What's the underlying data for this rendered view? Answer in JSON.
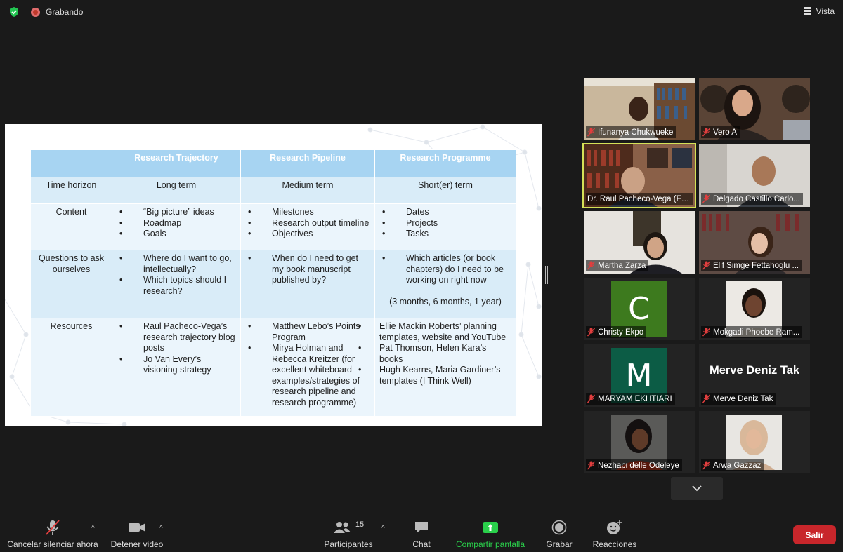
{
  "topbar": {
    "recording_label": "Grabando",
    "view_label": "Vista"
  },
  "slide": {
    "headers": [
      "",
      "Research Trajectory",
      "Research Pipeline",
      "Research Programme"
    ],
    "rows": [
      {
        "label": "Time horizon",
        "cells": [
          "Long term",
          "Medium term",
          "Short(er) term"
        ]
      },
      {
        "label": "Content",
        "lists": [
          [
            "“Big picture” ideas",
            "Roadmap",
            "Goals"
          ],
          [
            "Milestones",
            "Research output timeline",
            "Objectives"
          ],
          [
            "Dates",
            "Projects",
            "Tasks"
          ]
        ]
      },
      {
        "label": "Questions to ask ourselves",
        "lists": [
          [
            "Where do I want to go, intellectually?",
            "Which topics should I research?"
          ],
          [
            "When do I need to get my book manuscript published by?"
          ],
          [
            "Which articles (or book chapters) do I need to be working on right now"
          ]
        ],
        "note": "(3 months, 6 months, 1 year)"
      },
      {
        "label": "Resources",
        "lists": [
          [
            "Raul Pacheco-Vega’s research trajectory blog posts",
            "Jo Van Every’s visioning strategy"
          ],
          [
            "Matthew Lebo’s Points Program",
            "Mirya Holman and Rebecca Kreitzer (for excellent whiteboard examples/strategies of research pipeline and research programme)"
          ],
          [
            "Ellie Mackin Roberts’ planning templates, website and YouTube",
            "Pat Thomson, Helen Kara’s books",
            "Hugh Kearns, Maria Gardiner’s templates (I Think Well)"
          ]
        ]
      }
    ]
  },
  "participants": [
    {
      "name": "Ifunanya Chukwueke",
      "type": "video"
    },
    {
      "name": "Vero A",
      "type": "video"
    },
    {
      "name": "Dr. Raul Pacheco-Vega (FL...",
      "type": "video",
      "active": true
    },
    {
      "name": "Delgado Castillo Carlo...",
      "type": "video"
    },
    {
      "name": "Martha Zarza",
      "type": "video"
    },
    {
      "name": "Elif Simge Fettahoglu ...",
      "type": "video"
    },
    {
      "name": "Christy Ekpo",
      "type": "avatar",
      "initial": "C",
      "color": "#3d7a1e"
    },
    {
      "name": "Mokgadi Phoebe Ram...",
      "type": "photo"
    },
    {
      "name": "MARYAM EKHTIARI",
      "type": "avatar",
      "initial": "M",
      "color": "#0c5c45"
    },
    {
      "name": "Merve Deniz Tak",
      "type": "namecard",
      "card": "Merve Deniz Tak"
    },
    {
      "name": "Nezhapi delle Odeleye",
      "type": "photo"
    },
    {
      "name": "Arwa Gazzaz",
      "type": "photo"
    }
  ],
  "toolbar": {
    "unmute": "Cancelar silenciar ahora",
    "stop_video": "Detener video",
    "participants": "Participantes",
    "participants_count": "15",
    "chat": "Chat",
    "share": "Compartir pantalla",
    "record": "Grabar",
    "reactions": "Reacciones",
    "leave": "Salir"
  },
  "colors": {
    "accent_share": "#2ad04b",
    "leave": "#c8262b",
    "active_speaker": "#d4e157",
    "header_blue": "#a7d4f2"
  }
}
